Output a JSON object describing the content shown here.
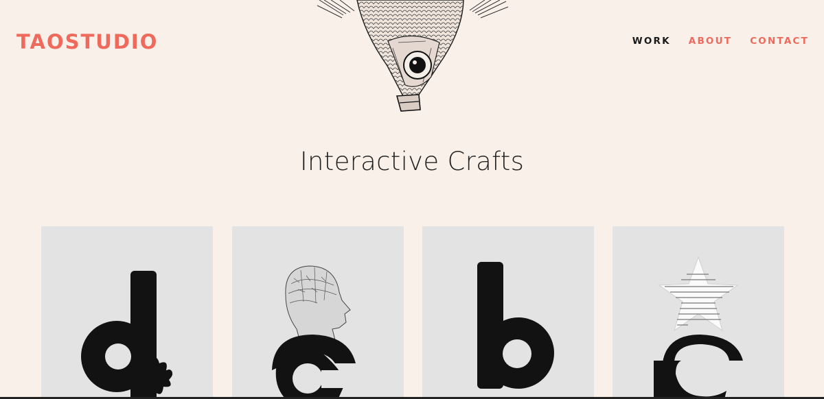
{
  "brand": {
    "logo_text": "TAOSTUDIO",
    "accent_color": "#ee6a5c",
    "background": "#f9f0ea"
  },
  "nav": {
    "items": [
      {
        "label": "WORK",
        "active": true
      },
      {
        "label": "ABOUT",
        "active": false
      },
      {
        "label": "CONTACT",
        "active": false
      }
    ]
  },
  "hero": {
    "illustration": "engraved-fish-icon"
  },
  "section": {
    "title": "Interactive Crafts"
  },
  "cards": [
    {
      "letter": "d",
      "decoration": "splash"
    },
    {
      "letter": "c",
      "decoration": "phrenology-head"
    },
    {
      "letter": "b",
      "decoration": "none"
    },
    {
      "letter": "c",
      "decoration": "code-star"
    }
  ]
}
